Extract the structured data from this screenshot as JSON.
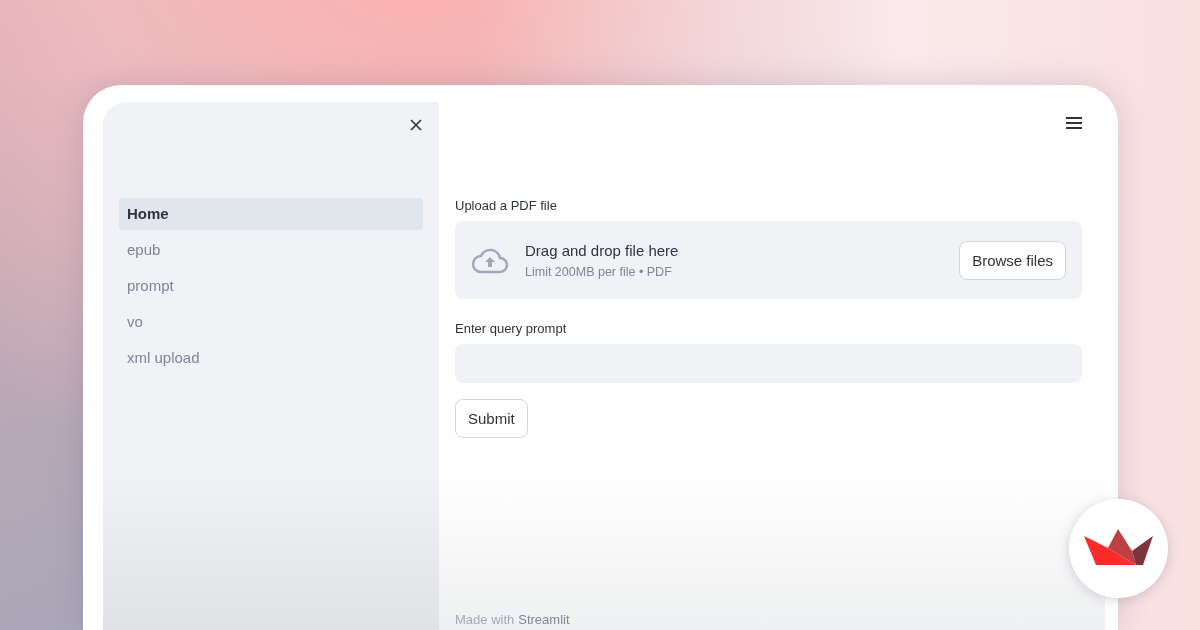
{
  "sidebar": {
    "items": [
      {
        "label": "Home",
        "selected": true
      },
      {
        "label": "epub",
        "selected": false
      },
      {
        "label": "prompt",
        "selected": false
      },
      {
        "label": "vo",
        "selected": false
      },
      {
        "label": "xml upload",
        "selected": false
      }
    ]
  },
  "uploader": {
    "label": "Upload a PDF file",
    "title": "Drag and drop file here",
    "hint": "Limit 200MB per file • PDF",
    "button": "Browse files"
  },
  "query": {
    "label": "Enter query prompt"
  },
  "submit": "Submit",
  "footer": {
    "prefix": "Made with",
    "link": "Streamlit"
  }
}
